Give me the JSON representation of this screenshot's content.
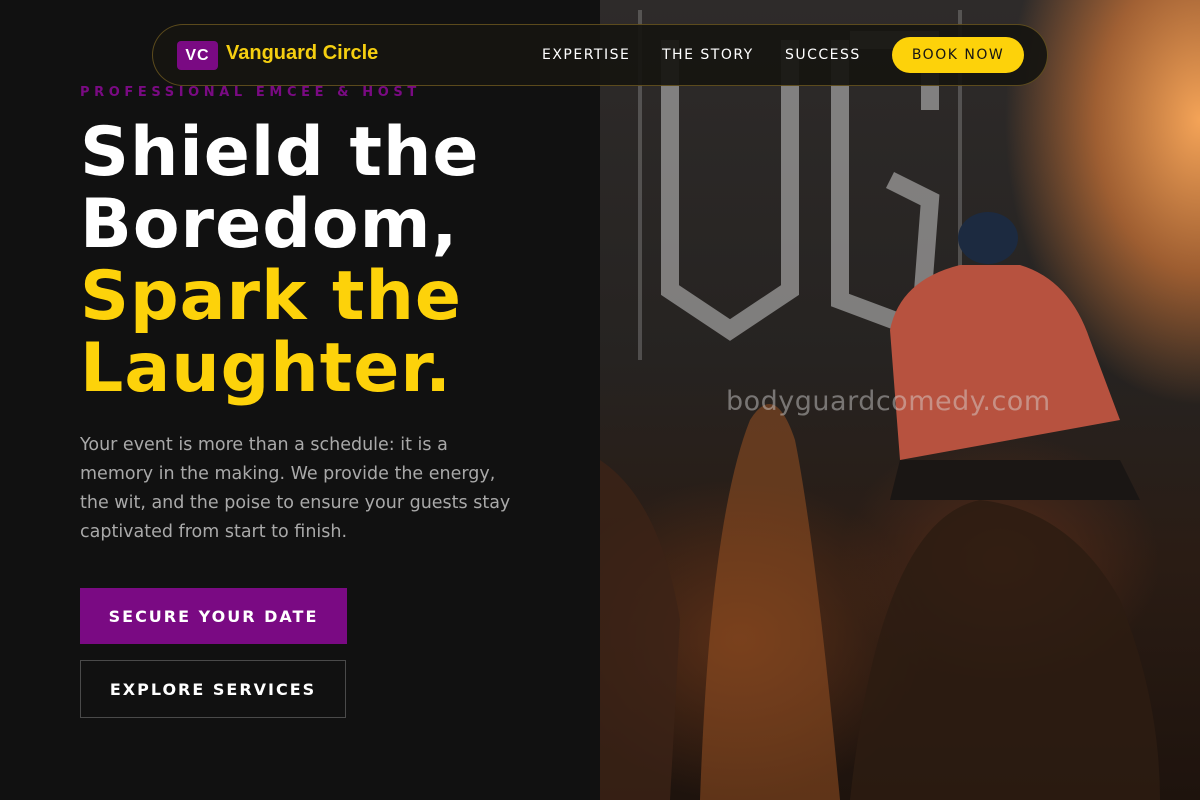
{
  "nav": {
    "logo_badge": "VC",
    "brand_name": "Vanguard Circle",
    "links": [
      "EXPERTISE",
      "THE STORY",
      "SUCCESS"
    ],
    "cta_label": "BOOK NOW"
  },
  "hero": {
    "eyebrow": "PROFESSIONAL EMCEE & HOST",
    "headline_white": [
      "Shield the",
      "Boredom,"
    ],
    "headline_accent": [
      "Spark the",
      "Laughter."
    ],
    "lede": "Your event is more than a schedule: it is a memory in the making. We provide the energy, the wit, and the poise to ensure your guests stay captivated from start to finish.",
    "primary_cta": "SECURE YOUR DATE",
    "secondary_cta": "EXPLORE SERVICES"
  },
  "image": {
    "watermark": "bodyguardcomedy.com",
    "alt_subject": "dj-performing-on-stage-photo"
  },
  "colors": {
    "brand_purple": "#7a0a83",
    "brand_yellow": "#fdd20a",
    "background": "#111111",
    "body_text": "#a9a9a9"
  }
}
